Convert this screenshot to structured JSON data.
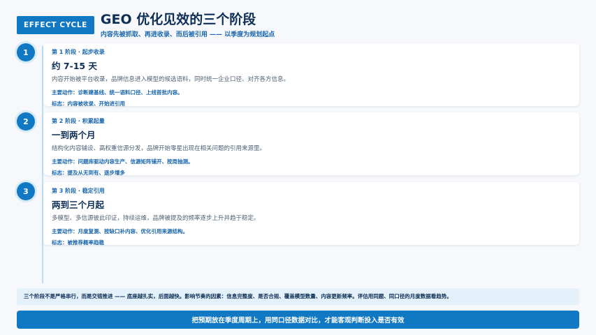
{
  "header": {
    "badge": "EFFECT CYCLE",
    "title": "GEO 优化见效的三个阶段",
    "subtitle": "内容先被抓取、再进收录、而后被引用 —— 以季度为规划起点"
  },
  "stages": [
    {
      "number": "1",
      "kicker": "第 1 阶段 · 起步收录",
      "title": "约 7-15 天",
      "description": "内容开始被平台收录，品牌信息进入模型的候选语料，同时统一企业口径、对齐各方信息。",
      "actions": "主要动作：诊断建基线、统一语料口径、上线首批内容。",
      "mark": "标志：内容被收录、开始进引用"
    },
    {
      "number": "2",
      "kicker": "第 2 阶段 · 积累起量",
      "title": "一到两个月",
      "description": "结构化内容铺设、高权重信源分发，品牌开始零星出现在相关问题的引用来源里。",
      "actions": "主要动作：问题库驱动内容生产、信源矩阵铺开、按周抽测。",
      "mark": "标志：提及从无到有、逐步增多"
    },
    {
      "number": "3",
      "kicker": "第 3 阶段 · 稳定引用",
      "title": "两到三个月起",
      "description": "多模型、多信源彼此印证，持续运维，品牌被提及的频率逐步上升并趋于稳定。",
      "actions": "主要动作：月度复测、按缺口补内容、优化引用来源结构。",
      "mark": "标志：被推荐概率趋稳"
    }
  ],
  "note": "三个阶段不是严格串行，而是交错推进 —— 底座越扎实，后面越快。影响节奏的因素：信息完整度、是否合规、覆盖模型数量、内容更新频率。评估用同题、同口径的月度数据看趋势。",
  "cta": "把预期放在季度周期上，用同口径数据对比，才能客观判断投入是否有效"
}
